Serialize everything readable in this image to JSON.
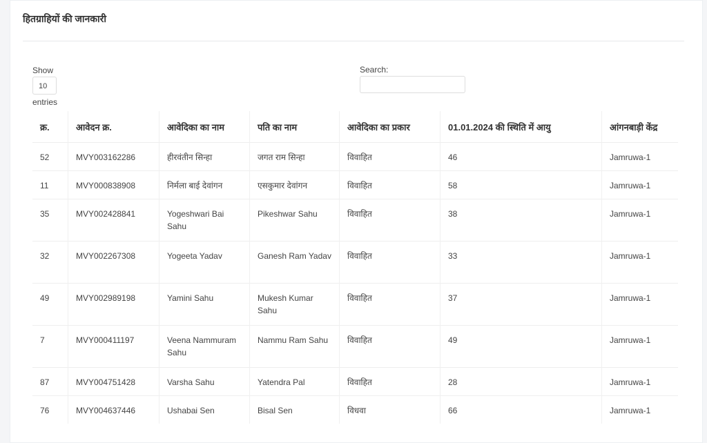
{
  "page": {
    "title": "हितग्राहियों की जानकारी"
  },
  "controls": {
    "show_label": "Show",
    "length_value": "10",
    "entries_label": "entries",
    "search_label": "Search:",
    "search_value": ""
  },
  "table": {
    "headers": [
      "क्र.",
      "आवेदन क्र.",
      "आवेदिका का नाम",
      "पति का नाम",
      "आवेदिका का प्रकार",
      "01.01.2024 की स्थिति में आयु",
      "आंगनबाड़ी केंद्र"
    ],
    "rows": [
      [
        "52",
        "MVY003162286",
        "हीरवंतीन सिन्हा",
        "जगत राम सिन्हा",
        "विवाहित",
        "46",
        "Jamruwa-1"
      ],
      [
        "11",
        "MVY000838908",
        "निर्मला बाई देवांगन",
        "एसकुमार देवांगन",
        "विवाहित",
        "58",
        "Jamruwa-1"
      ],
      [
        "35",
        "MVY002428841",
        "Yogeshwari Bai Sahu",
        "Pikeshwar Sahu",
        "विवाहित",
        "38",
        "Jamruwa-1"
      ],
      [
        "32",
        "MVY002267308",
        "Yogeeta Yadav",
        "Ganesh Ram Yadav",
        "विवाहित",
        "33",
        "Jamruwa-1"
      ],
      [
        "49",
        "MVY002989198",
        "Yamini Sahu",
        "Mukesh Kumar Sahu",
        "विवाहित",
        "37",
        "Jamruwa-1"
      ],
      [
        "7",
        "MVY000411197",
        "Veena Nammuram Sahu",
        "Nammu Ram Sahu",
        "विवाहित",
        "49",
        "Jamruwa-1"
      ],
      [
        "87",
        "MVY004751428",
        "Varsha Sahu",
        "Yatendra Pal",
        "विवाहित",
        "28",
        "Jamruwa-1"
      ],
      [
        "76",
        "MVY004637446",
        "Ushabai Sen",
        "Bisal Sen",
        "विधवा",
        "66",
        "Jamruwa-1"
      ]
    ]
  }
}
